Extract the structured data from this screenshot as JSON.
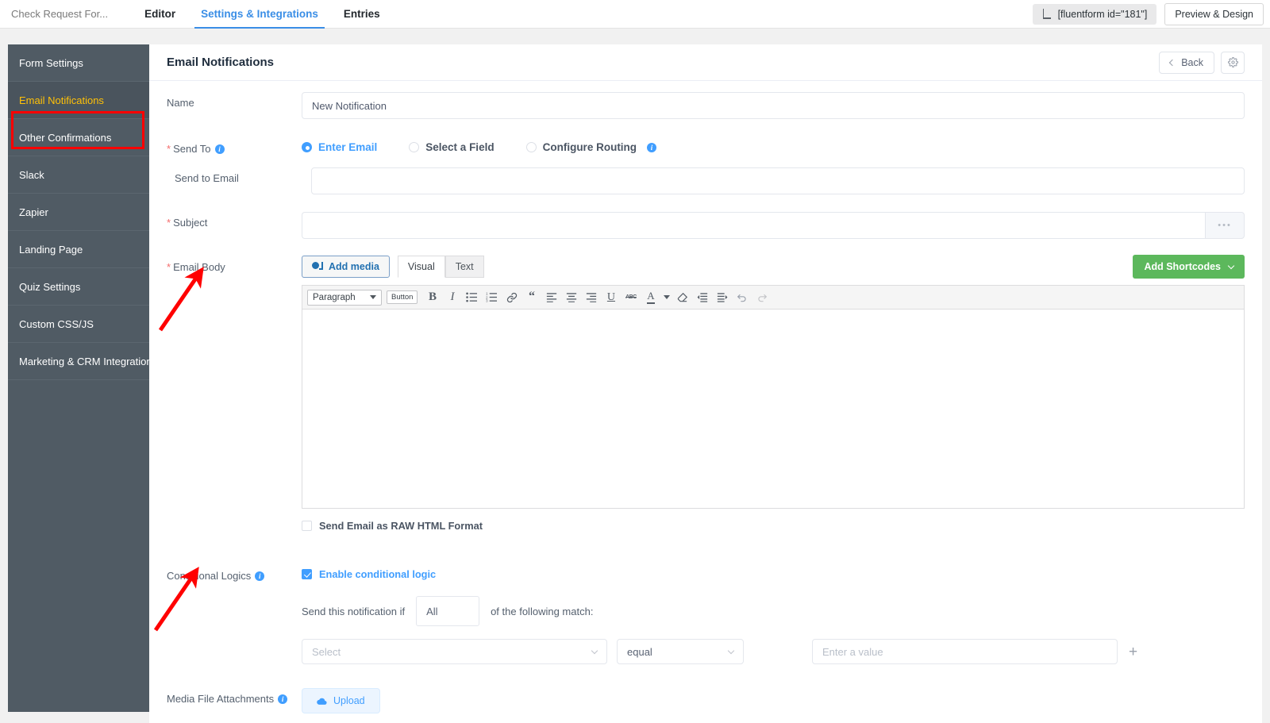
{
  "topbar": {
    "site_title": "Check Request For...",
    "tabs": [
      {
        "label": "Editor",
        "active": false
      },
      {
        "label": "Settings & Integrations",
        "active": true
      },
      {
        "label": "Entries",
        "active": false
      }
    ],
    "shortcode": "[fluentform id=\"181\"]",
    "shortcode_icon": "shortcode-bracket-icon",
    "preview_label": "Preview & Design"
  },
  "sidebar": {
    "items": [
      {
        "label": "Form Settings"
      },
      {
        "label": "Email Notifications"
      },
      {
        "label": "Other Confirmations"
      },
      {
        "label": "Slack"
      },
      {
        "label": "Zapier"
      },
      {
        "label": "Landing Page"
      },
      {
        "label": "Quiz Settings"
      },
      {
        "label": "Custom CSS/JS"
      },
      {
        "label": "Marketing & CRM Integrations"
      }
    ],
    "active_index": 1,
    "active_color": "#ffc107",
    "highlight_color": "#ff0000",
    "background": "#505b64"
  },
  "main": {
    "title": "Email Notifications",
    "back_label": "Back",
    "back_icon": "chevron-left-icon",
    "gear_icon": "gear-icon",
    "name": {
      "label": "Name",
      "value": "New Notification"
    },
    "send_to": {
      "label": "Send To",
      "info_icon": "info-icon",
      "options": [
        {
          "label": "Enter Email",
          "selected": true,
          "info": false
        },
        {
          "label": "Select a Field",
          "selected": false,
          "info": false
        },
        {
          "label": "Configure Routing",
          "selected": false,
          "info": true
        }
      ],
      "sub_label": "Send to Email",
      "sub_value": "",
      "sub_placeholder": ""
    },
    "subject": {
      "label": "Subject",
      "value": "",
      "placeholder": "",
      "more_icon": "ellipsis-icon"
    },
    "email_body": {
      "label": "Email Body",
      "add_media_label": "Add media",
      "add_media_icon": "media-icon",
      "editor_tabs": [
        {
          "label": "Visual",
          "active": true
        },
        {
          "label": "Text",
          "active": false
        }
      ],
      "shortcodes_label": "Add Shortcodes",
      "shortcodes_icon": "chevron-down-icon",
      "shortcodes_color": "#5cb85c",
      "format_select": "Paragraph",
      "button_chip": "Button",
      "toolbar_icons": [
        "bold-icon",
        "italic-icon",
        "bulleted-list-icon",
        "numbered-list-icon",
        "link-icon",
        "blockquote-icon",
        "align-left-icon",
        "align-center-icon",
        "align-right-icon",
        "underline-icon",
        "strikethrough-icon",
        "text-color-icon",
        "text-color-dropdown-icon",
        "clear-formatting-icon",
        "outdent-icon",
        "indent-icon",
        "undo-icon",
        "redo-icon"
      ],
      "content": "",
      "resize_handle_icon": "resize-handle-icon"
    },
    "raw_html": {
      "label": "Send Email as RAW HTML Format",
      "checked": false
    },
    "conditional_logics": {
      "label": "Conditional Logics",
      "info_icon": "info-icon",
      "enable_label": "Enable conditional logic",
      "enabled": true,
      "sentence_prefix": "Send this notification if",
      "match_type": "All",
      "sentence_suffix": "of the following match:",
      "condition": {
        "field_placeholder": "Select",
        "operator_value": "equal",
        "value_placeholder": "Enter a value",
        "add_icon": "plus-icon"
      }
    },
    "media_attachments": {
      "label": "Media File Attachments",
      "info_icon": "info-icon",
      "upload_label": "Upload",
      "upload_icon": "cloud-upload-icon"
    }
  },
  "annotations": {
    "arrows": [
      {
        "name": "arrow-to-email-body",
        "color": "#ff0000"
      },
      {
        "name": "arrow-to-conditional-logics",
        "color": "#ff0000"
      }
    ]
  }
}
